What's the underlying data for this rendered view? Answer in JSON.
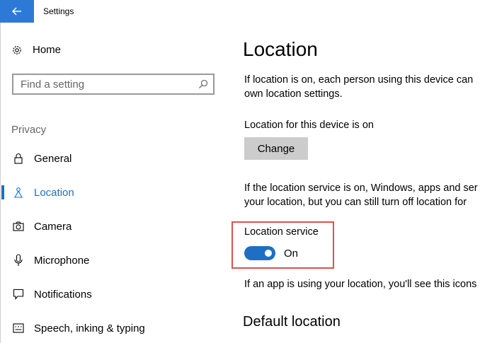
{
  "window": {
    "title": "Settings"
  },
  "colors": {
    "accent": "#1e6fc4",
    "back_button": "#2d7ad6",
    "highlight": "#d9534f"
  },
  "sidebar": {
    "home_label": "Home",
    "search": {
      "placeholder": "Find a setting"
    },
    "section_label": "Privacy",
    "items": [
      {
        "label": "General",
        "icon": "lock-icon",
        "active": false
      },
      {
        "label": "Location",
        "icon": "location-icon",
        "active": true
      },
      {
        "label": "Camera",
        "icon": "camera-icon",
        "active": false
      },
      {
        "label": "Microphone",
        "icon": "microphone-icon",
        "active": false
      },
      {
        "label": "Notifications",
        "icon": "notifications-icon",
        "active": false
      },
      {
        "label": "Speech, inking & typing",
        "icon": "speech-icon",
        "active": false
      }
    ]
  },
  "main": {
    "title": "Location",
    "intro_line1": "If location is on, each person using this device can",
    "intro_line2": "own location settings.",
    "device_status": "Location for this device is on",
    "change_button": "Change",
    "service_desc_line1": "If the location service is on, Windows, apps and ser",
    "service_desc_line2": "your location, but you can still turn off location for",
    "service_label": "Location service",
    "service_state": "On",
    "service_on": true,
    "icon_desc": "If an app is using your location, you'll see this icons",
    "default_location_heading": "Default location"
  }
}
